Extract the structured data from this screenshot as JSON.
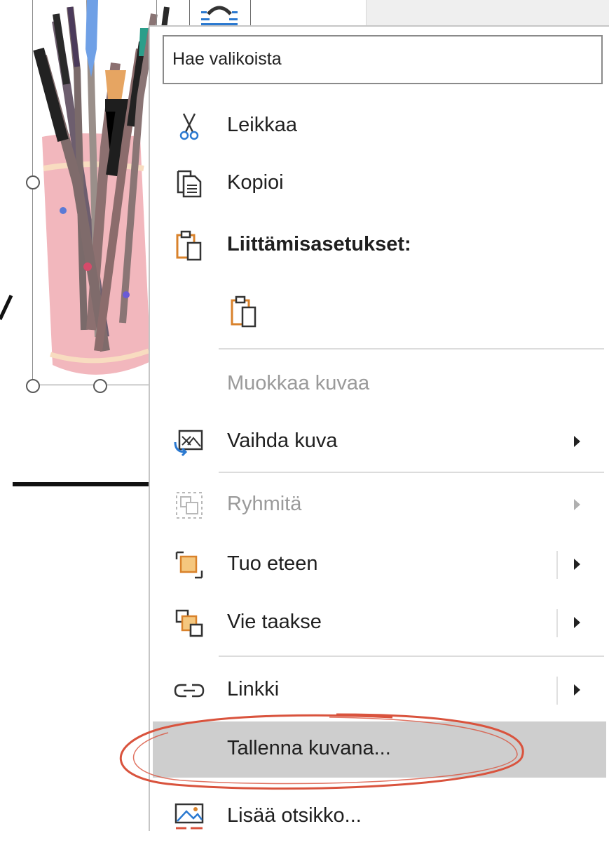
{
  "context_menu": {
    "search": {
      "placeholder": "Hae valikoista"
    },
    "items": [
      {
        "id": "cut",
        "label": "Leikkaa",
        "icon": "scissors-icon",
        "enabled": true,
        "submenu": false
      },
      {
        "id": "copy",
        "label": "Kopioi",
        "icon": "copy-icon",
        "enabled": true,
        "submenu": false
      },
      {
        "id": "paste_options",
        "label": "Liittämisasetukset:",
        "icon": "paste-icon",
        "enabled": true,
        "submenu": false
      },
      {
        "id": "edit_picture",
        "label": "Muokkaa kuvaa",
        "icon": "",
        "enabled": false,
        "submenu": false
      },
      {
        "id": "change_picture",
        "label": "Vaihda kuva",
        "icon": "change-picture-icon",
        "enabled": true,
        "submenu": true
      },
      {
        "id": "group",
        "label": "Ryhmitä",
        "icon": "group-icon",
        "enabled": false,
        "submenu": true
      },
      {
        "id": "bring_forward",
        "label": "Tuo eteen",
        "icon": "bring-forward-icon",
        "enabled": true,
        "submenu": true
      },
      {
        "id": "send_backward",
        "label": "Vie taakse",
        "icon": "send-backward-icon",
        "enabled": true,
        "submenu": true
      },
      {
        "id": "link",
        "label": "Linkki",
        "icon": "link-icon",
        "enabled": true,
        "submenu": true
      },
      {
        "id": "save_as_picture",
        "label": "Tallenna kuvana...",
        "icon": "",
        "enabled": true,
        "submenu": false,
        "highlighted": true
      },
      {
        "id": "insert_caption",
        "label": "Lisää otsikko...",
        "icon": "insert-caption-icon",
        "enabled": true,
        "submenu": false
      }
    ]
  },
  "colors": {
    "accent_blue": "#2b79d0",
    "accent_orange": "#d9822b",
    "highlight": "#cecece",
    "annotation_red": "#d9533d"
  }
}
